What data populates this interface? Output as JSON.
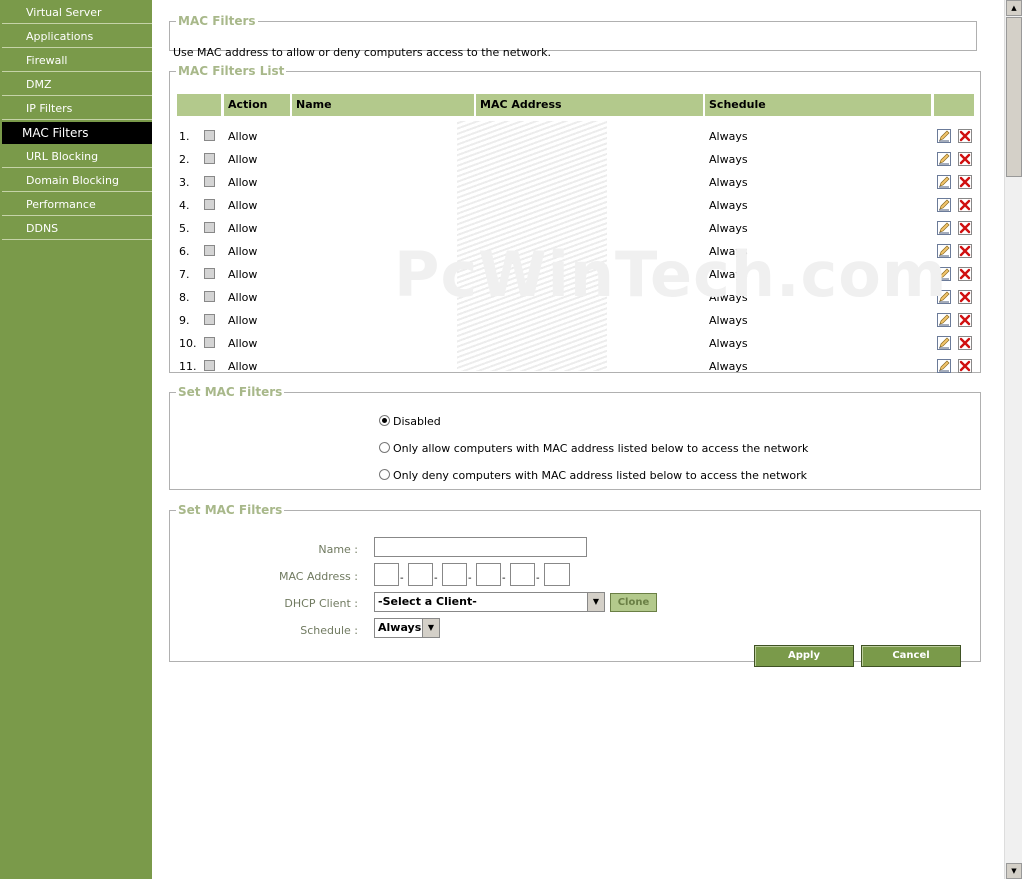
{
  "sidebar": {
    "items": [
      {
        "label": "Virtual Server",
        "active": false
      },
      {
        "label": "Applications",
        "active": false
      },
      {
        "label": "Firewall",
        "active": false
      },
      {
        "label": "DMZ",
        "active": false
      },
      {
        "label": "IP Filters",
        "active": false
      },
      {
        "label": "MAC Filters",
        "active": true
      },
      {
        "label": "URL Blocking",
        "active": false
      },
      {
        "label": "Domain Blocking",
        "active": false
      },
      {
        "label": "Performance",
        "active": false
      },
      {
        "label": "DDNS",
        "active": false
      }
    ]
  },
  "intro": {
    "legend": "MAC Filters",
    "description": "Use MAC address to allow or deny computers access to the network."
  },
  "list": {
    "legend": "MAC Filters List",
    "columns": {
      "action": "Action",
      "name": "Name",
      "mac": "MAC Address",
      "schedule": "Schedule"
    },
    "rows": [
      {
        "num": "1.",
        "action": "Allow",
        "name": "",
        "schedule": "Always"
      },
      {
        "num": "2.",
        "action": "Allow",
        "name": "",
        "schedule": "Always"
      },
      {
        "num": "3.",
        "action": "Allow",
        "name": "",
        "schedule": "Always"
      },
      {
        "num": "4.",
        "action": "Allow",
        "name": "",
        "schedule": "Always"
      },
      {
        "num": "5.",
        "action": "Allow",
        "name": "",
        "schedule": "Always"
      },
      {
        "num": "6.",
        "action": "Allow",
        "name": "",
        "schedule": "Always"
      },
      {
        "num": "7.",
        "action": "Allow",
        "name": "",
        "schedule": "Always"
      },
      {
        "num": "8.",
        "action": "Allow",
        "name": "",
        "schedule": "Always"
      },
      {
        "num": "9.",
        "action": "Allow",
        "name": "",
        "schedule": "Always"
      },
      {
        "num": "10.",
        "action": "Allow",
        "name": "",
        "schedule": "Always"
      },
      {
        "num": "11.",
        "action": "Allow",
        "name": "",
        "schedule": "Always"
      }
    ]
  },
  "mode": {
    "legend": "Set MAC Filters",
    "options": [
      {
        "label": "Disabled",
        "selected": true
      },
      {
        "label": "Only allow computers with MAC address listed below to access the network",
        "selected": false
      },
      {
        "label": "Only deny computers with MAC address listed below to access the network",
        "selected": false
      }
    ]
  },
  "form": {
    "legend": "Set MAC Filters",
    "name_label": "Name :",
    "name_value": "",
    "mac_label": "MAC Address :",
    "mac_sep": "-",
    "dhcp_label": "DHCP Client :",
    "dhcp_value": "-Select a Client-",
    "clone_label": "Clone",
    "schedule_label": "Schedule :",
    "schedule_value": "Always",
    "apply_label": "Apply",
    "cancel_label": "Cancel"
  },
  "watermark": "PcWinTech.com",
  "colors": {
    "sidebar": "#7a9a4a",
    "active": "#000000",
    "header": "#b3c98c",
    "legend": "#a8b88a"
  }
}
